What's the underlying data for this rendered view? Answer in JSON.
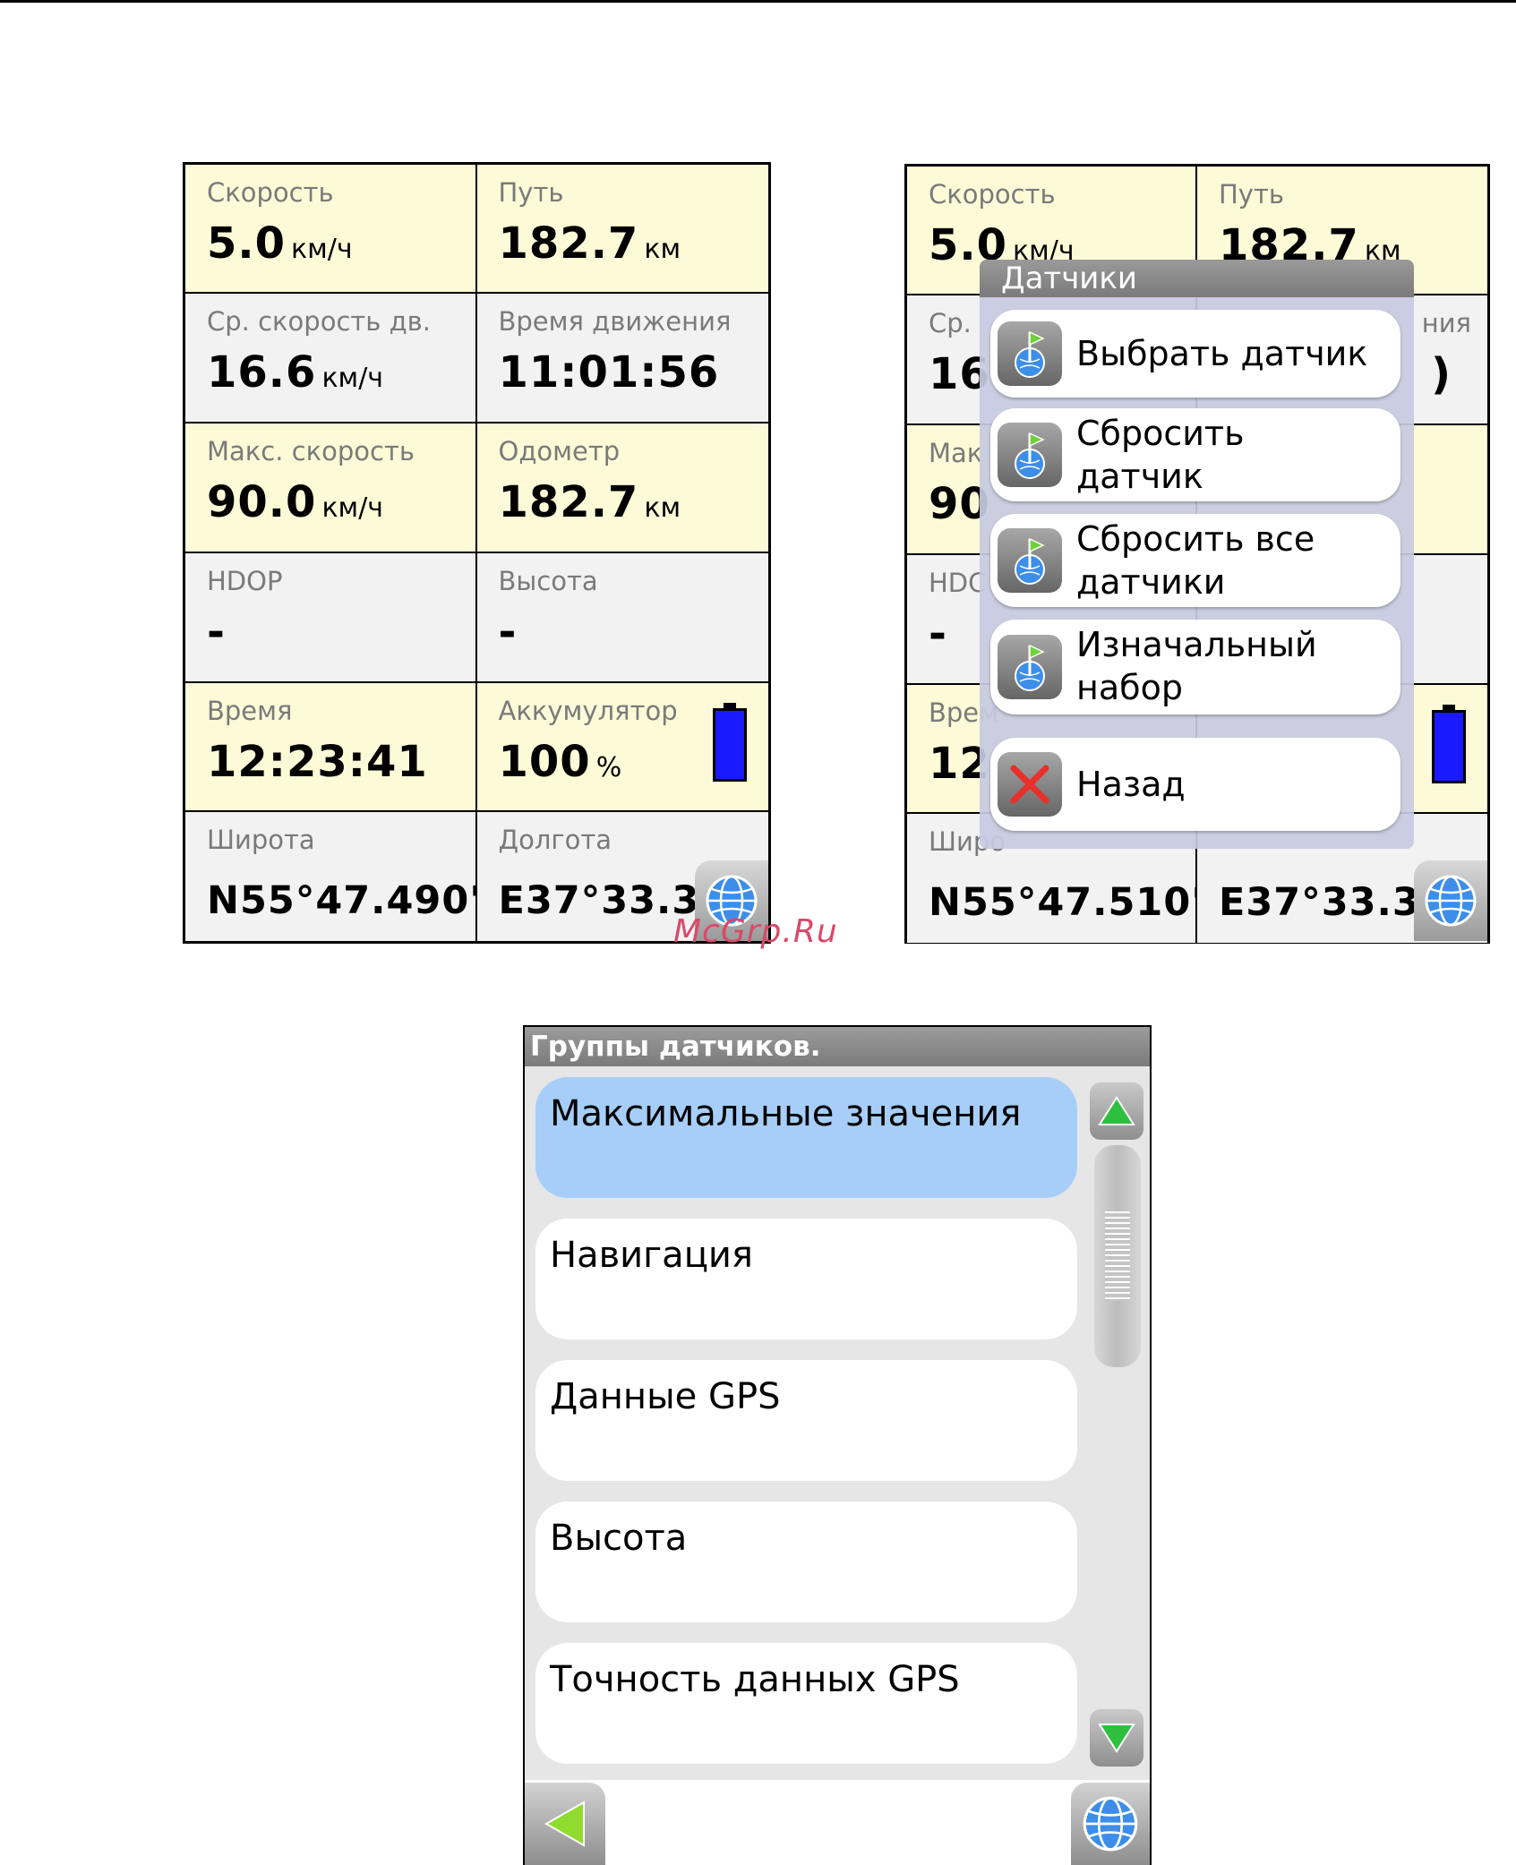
{
  "screen1": {
    "cells": [
      {
        "label": "Скорость",
        "value": "5.0",
        "unit": "км/ч"
      },
      {
        "label": "Путь",
        "value": "182.7",
        "unit": "км"
      },
      {
        "label": "Ср. скорость дв.",
        "value": "16.6",
        "unit": "км/ч"
      },
      {
        "label": "Время движения",
        "value": "11:01:56",
        "unit": ""
      },
      {
        "label": "Макс. скорость",
        "value": "90.0",
        "unit": "км/ч"
      },
      {
        "label": "Одометр",
        "value": "182.7",
        "unit": "км"
      },
      {
        "label": "HDOP",
        "value": "-",
        "unit": ""
      },
      {
        "label": "Высота",
        "value": "-",
        "unit": ""
      },
      {
        "label": "Время",
        "value": "12:23:41",
        "unit": ""
      },
      {
        "label": "Аккумулятор",
        "value": "100",
        "unit": "%"
      },
      {
        "label": "Широта",
        "value": "N55°47.490'",
        "unit": ""
      },
      {
        "label": "Долгота",
        "value": "E37°33.3",
        "unit": ""
      }
    ],
    "battery_level": 1.0
  },
  "screen2": {
    "cells": [
      {
        "label": "Скорость",
        "value": "5.0",
        "unit": "км/ч"
      },
      {
        "label": "Путь",
        "value": "182.7",
        "unit": "км"
      },
      {
        "label": "Ср.",
        "value": "16",
        "unit": ""
      },
      {
        "label": "ния",
        "value": ")",
        "unit": ""
      },
      {
        "label": "Мак",
        "value": "90",
        "unit": ""
      },
      {
        "label": "",
        "value": "",
        "unit": ""
      },
      {
        "label": "HDC",
        "value": "-",
        "unit": ""
      },
      {
        "label": "",
        "value": "",
        "unit": ""
      },
      {
        "label": "Врем",
        "value": "12",
        "unit": ""
      },
      {
        "label": "",
        "value": "",
        "unit": ""
      },
      {
        "label": "Широ",
        "value": "N55°47.510'",
        "unit": ""
      },
      {
        "label": "",
        "value": "E37°33.3",
        "unit": ""
      }
    ],
    "popup": {
      "title": "Датчики",
      "items": [
        {
          "text": "Выбрать датчик",
          "icon": "sensor-globe-icon"
        },
        {
          "text": "Сбросить датчик",
          "icon": "sensor-globe-icon"
        },
        {
          "text": "Сбросить все датчики",
          "icon": "sensor-globe-icon"
        },
        {
          "text": "Изначальный набор",
          "icon": "sensor-globe-icon"
        },
        {
          "text": "Назад",
          "icon": "close-x-icon"
        }
      ]
    }
  },
  "screen3": {
    "title": "Группы датчиков.",
    "items": [
      {
        "text": "Максимальные значения",
        "selected": true
      },
      {
        "text": "Навигация",
        "selected": false
      },
      {
        "text": "Данные GPS",
        "selected": false
      },
      {
        "text": "Высота",
        "selected": false
      },
      {
        "text": "Точность данных GPS",
        "selected": false
      }
    ]
  },
  "watermark": "McGrp.Ru",
  "colors": {
    "cell_yellow": "#fdfad7",
    "cell_grey": "#f2f2f2",
    "selected_item": "#a6cef8",
    "battery": "#1a1aff",
    "scroll_arrow": "#2fbf3f"
  }
}
